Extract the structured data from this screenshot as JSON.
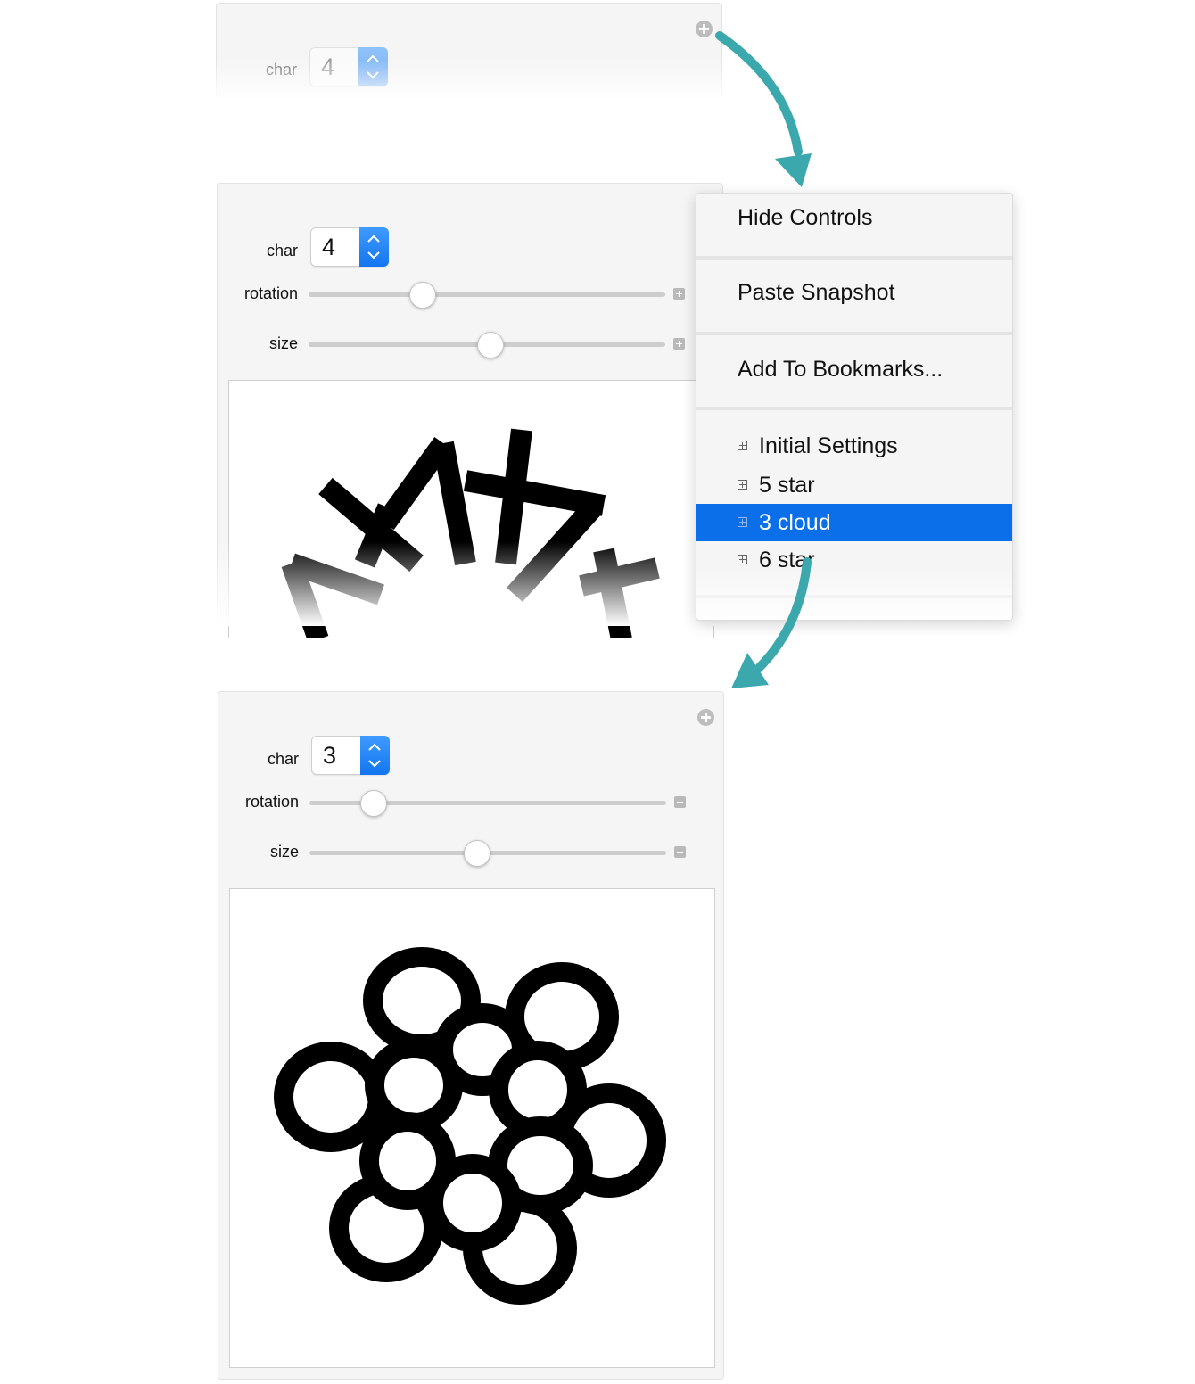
{
  "panel_top": {
    "char_label": "char",
    "char_value": "4"
  },
  "panel_middle": {
    "char_label": "char",
    "char_value": "4",
    "rotation_label": "rotation",
    "rotation_value": 0.32,
    "size_label": "size",
    "size_value": 0.51
  },
  "context_menu": {
    "hide_controls": "Hide Controls",
    "paste_snapshot": "Paste Snapshot",
    "add_bookmarks": "Add To Bookmarks...",
    "bookmarks": [
      {
        "label": "Initial Settings",
        "selected": false
      },
      {
        "label": "5 star",
        "selected": false
      },
      {
        "label": "3 cloud",
        "selected": true
      },
      {
        "label": "6 star",
        "selected": false
      }
    ]
  },
  "panel_bottom": {
    "char_label": "char",
    "char_value": "3",
    "rotation_label": "rotation",
    "rotation_value": 0.18,
    "size_label": "size",
    "size_value": 0.47
  },
  "colors": {
    "accent": "#0a6fe8",
    "arrow": "#3aa8ad",
    "panel_bg": "#f5f5f5"
  }
}
